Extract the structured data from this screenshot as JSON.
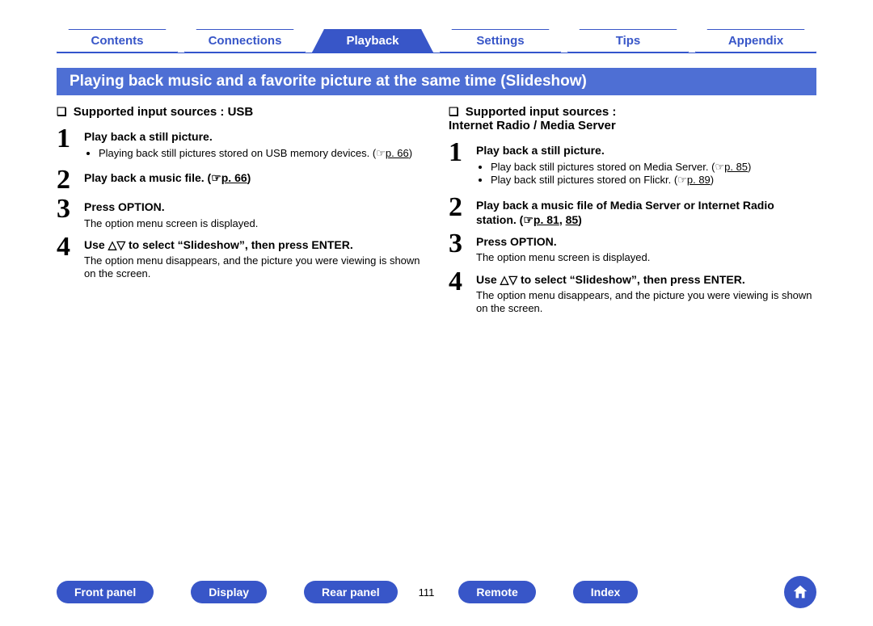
{
  "nav": {
    "tabs": [
      "Contents",
      "Connections",
      "Playback",
      "Settings",
      "Tips",
      "Appendix"
    ],
    "active_index": 2
  },
  "title": "Playing back music and a favorite picture at the same time (Slideshow)",
  "left": {
    "heading": "Supported input sources : USB",
    "steps": [
      {
        "num": "1",
        "title": "Play back a still picture.",
        "bullets": [
          {
            "text": "Playing back still pictures stored on USB memory devices.   (",
            "pagelink": "p. 66",
            "tail": ")"
          }
        ]
      },
      {
        "num": "2",
        "title_prefix": "Play back a music file.   (",
        "pagelink": "p. 66",
        "title_suffix": ")"
      },
      {
        "num": "3",
        "title": "Press OPTION.",
        "desc": "The option menu screen is displayed."
      },
      {
        "num": "4",
        "title": "Use △▽ to select “Slideshow”, then press ENTER.",
        "desc": "The option menu disappears, and the picture you were viewing is shown on the screen."
      }
    ]
  },
  "right": {
    "heading_line1": "Supported input sources :",
    "heading_line2": "Internet Radio / Media Server",
    "steps": [
      {
        "num": "1",
        "title": "Play back a still picture.",
        "bullets": [
          {
            "text": "Play back still pictures stored on Media Server.   (",
            "pagelink": "p. 85",
            "tail": ")"
          },
          {
            "text": "Play back still pictures stored on Flickr.   (",
            "pagelink": "p. 89",
            "tail": ")"
          }
        ]
      },
      {
        "num": "2",
        "title_prefix": "Play back a music file of Media Server or Internet Radio station.   (",
        "pagelink": "p. 81",
        "mid": ",  ",
        "pagelink2": "85",
        "title_suffix": ")"
      },
      {
        "num": "3",
        "title": "Press OPTION.",
        "desc": "The option menu screen is displayed."
      },
      {
        "num": "4",
        "title": "Use △▽ to select “Slideshow”, then press ENTER.",
        "desc": "The option menu disappears, and the picture you were viewing is shown on the screen."
      }
    ]
  },
  "footer": {
    "pills": [
      "Front panel",
      "Display",
      "Rear panel"
    ],
    "page": "111",
    "pills2": [
      "Remote",
      "Index"
    ]
  }
}
